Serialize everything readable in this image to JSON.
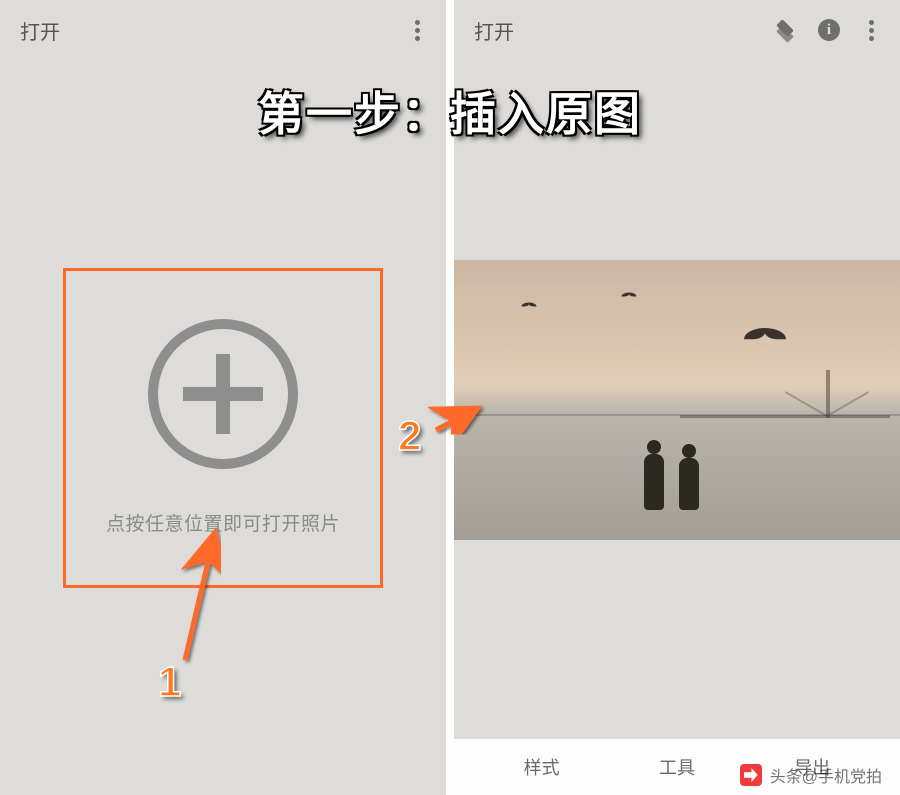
{
  "annotation": {
    "step_title": "第一步：插入原图",
    "marker1": "1",
    "marker2": "2",
    "watermark": "头条@手机党拍"
  },
  "left_panel": {
    "open_label": "打开",
    "hint": "点按任意位置即可打开照片"
  },
  "right_panel": {
    "open_label": "打开",
    "info_glyph": "i",
    "tabs": {
      "styles": "样式",
      "tools": "工具",
      "export": "导出"
    }
  }
}
